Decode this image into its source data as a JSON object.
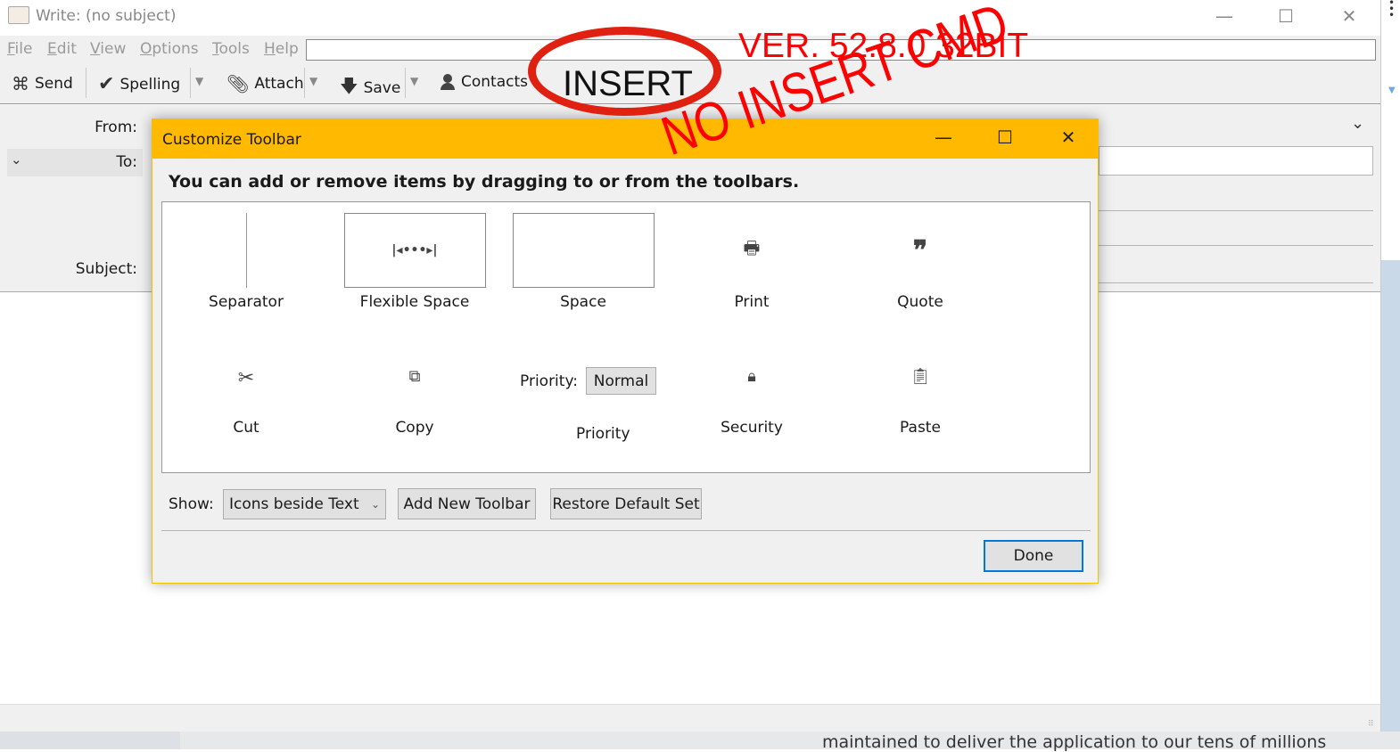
{
  "window": {
    "title": "Write: (no subject)",
    "minimize": "—",
    "maximize": "☐",
    "close": "✕"
  },
  "menu": [
    {
      "label": "File",
      "u": "F",
      "rest": "ile"
    },
    {
      "label": "Edit",
      "u": "E",
      "rest": "dit"
    },
    {
      "label": "View",
      "u": "V",
      "rest": "iew"
    },
    {
      "label": "Options",
      "u": "O",
      "rest": "ptions"
    },
    {
      "label": "Tools",
      "u": "T",
      "rest": "ools"
    },
    {
      "label": "Help",
      "u": "H",
      "rest": "elp"
    }
  ],
  "toolbar": {
    "send": "Send",
    "spelling": "Spelling",
    "attach": "Attach",
    "save": "Save",
    "contacts": "Contacts"
  },
  "header": {
    "from": "From:",
    "to": "To:",
    "subject": "Subject:"
  },
  "background_text": "maintained to deliver the application to our tens of millions",
  "dialog": {
    "title": "Customize Toolbar",
    "instructions": "You can add or remove items by dragging to or from the toolbars.",
    "items": [
      {
        "label": "Separator",
        "icon": "separator-icon"
      },
      {
        "label": "Flexible Space",
        "icon": "flexible-space-icon"
      },
      {
        "label": "Space",
        "icon": "space-icon"
      },
      {
        "label": "Print",
        "icon": "print-icon"
      },
      {
        "label": "Quote",
        "icon": "quote-icon"
      },
      {
        "label": "Cut",
        "icon": "scissors-icon"
      },
      {
        "label": "Copy",
        "icon": "copy-icon"
      },
      {
        "label": "Priority",
        "icon": "priority-select"
      },
      {
        "label": "Security",
        "icon": "lock-icon"
      },
      {
        "label": "Paste",
        "icon": "paste-icon"
      }
    ],
    "priority_label": "Priority:",
    "priority_value": "Normal",
    "show_label": "Show:",
    "show_value": "Icons beside Text",
    "add_toolbar": "Add New Toolbar",
    "restore": "Restore Default Set",
    "done": "Done"
  },
  "annotations": {
    "insert": "INSERT",
    "version": "VER. 52.8.0 32BIT",
    "no_insert": "NO INSERT CMD"
  },
  "colors": {
    "dialog_title": "#FFB900",
    "annotation": "#FF0000",
    "done_border": "#0078D7"
  }
}
